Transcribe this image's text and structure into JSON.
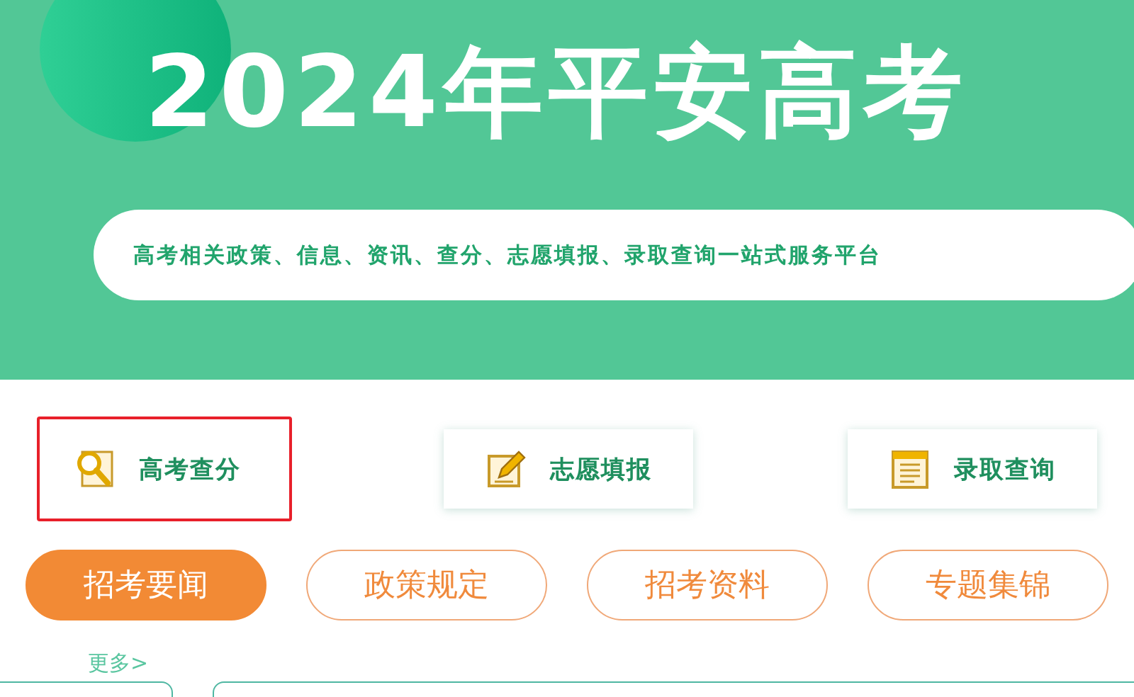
{
  "banner": {
    "title": "2024年平安高考",
    "subtitle": "高考相关政策、信息、资讯、查分、志愿填报、录取查询一站式服务平台"
  },
  "services": [
    {
      "kind": "search",
      "label": "高考查分",
      "highlighted": true
    },
    {
      "kind": "edit",
      "label": "志愿填报",
      "highlighted": false
    },
    {
      "kind": "list",
      "label": "录取查询",
      "highlighted": false
    }
  ],
  "tabs": [
    {
      "label": "招考要闻",
      "selected": true
    },
    {
      "label": "政策规定",
      "selected": false
    },
    {
      "label": "招考资料",
      "selected": false
    },
    {
      "label": "专题集锦",
      "selected": false
    }
  ],
  "more_link": "更多>"
}
